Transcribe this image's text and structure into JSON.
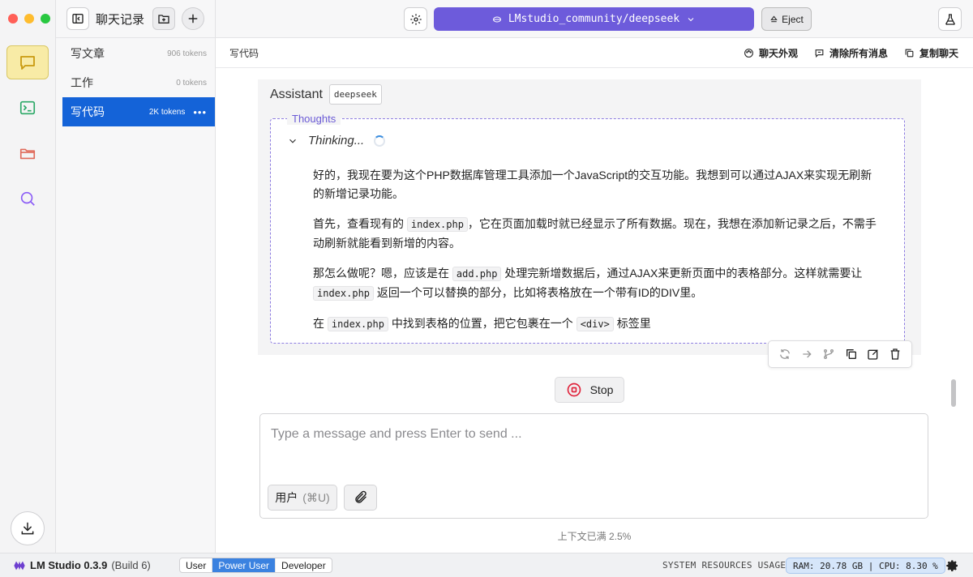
{
  "window": {
    "traffic": [
      "#ff5f57",
      "#febc2e",
      "#28c840"
    ]
  },
  "rail": {
    "items": [
      {
        "icon": "chat-icon",
        "color": "#d4a017",
        "active": true
      },
      {
        "icon": "terminal-icon",
        "color": "#2aa866"
      },
      {
        "icon": "folder-icon",
        "color": "#e06a5a"
      },
      {
        "icon": "search-icon",
        "color": "#8b5cf6"
      }
    ],
    "download_icon": "download-icon"
  },
  "sidebar": {
    "title": "聊天记录",
    "chats": [
      {
        "name": "写文章",
        "tokens": "906 tokens"
      },
      {
        "name": "工作",
        "tokens": "0 tokens"
      },
      {
        "name": "写代码",
        "tokens": "2K tokens",
        "more": "•••",
        "active": true
      }
    ]
  },
  "topbar": {
    "model": "LMstudio_community/deepseek",
    "eject": "Eject",
    "accent": "#6d5bdb"
  },
  "subbar": {
    "title": "写代码",
    "actions": [
      "聊天外观",
      "清除所有消息",
      "复制聊天"
    ]
  },
  "message": {
    "role": "Assistant",
    "model_badge": "deepseek",
    "thoughts_label": "Thoughts",
    "thinking": "Thinking...",
    "p1": "好的，我现在要为这个PHP数据库管理工具添加一个JavaScript的交互功能。我想到可以通过AJAX来实现无刷新的新增记录功能。",
    "p2_a": "首先，查看现有的",
    "p2_code": "index.php",
    "p2_b": "，它在页面加载时就已经显示了所有数据。现在，我想在添加新记录之后，不需手动刷新就能看到新增的内容。",
    "p3_a": "那怎么做呢？嗯，应该是在",
    "p3_code1": "add.php",
    "p3_b": "处理完新增数据后，通过AJAX来更新页面中的表格部分。这样就需要让",
    "p3_code2": "index.php",
    "p3_c": "返回一个可以替换的部分，比如将表格放在一个带有ID的DIV里。",
    "p4_a": "在",
    "p4_code1": "index.php",
    "p4_b": "中找到表格的位置，把它包裹在一个",
    "p4_code2": "<div>",
    "p4_c": "标签里"
  },
  "stop_label": "Stop",
  "composer": {
    "placeholder": "Type a message and press Enter to send ...",
    "role_label": "用户",
    "role_shortcut": "(⌘U)"
  },
  "context_usage": "上下文已满 2.5%",
  "statusbar": {
    "app": "LM Studio 0.3.9",
    "build": "(Build 6)",
    "modes": [
      "User",
      "Power User",
      "Developer"
    ],
    "active_mode": "Power User",
    "sys_label": "SYSTEM RESOURCES USAGE:",
    "sys_value": "RAM: 20.78 GB | CPU: 8.30 %"
  }
}
